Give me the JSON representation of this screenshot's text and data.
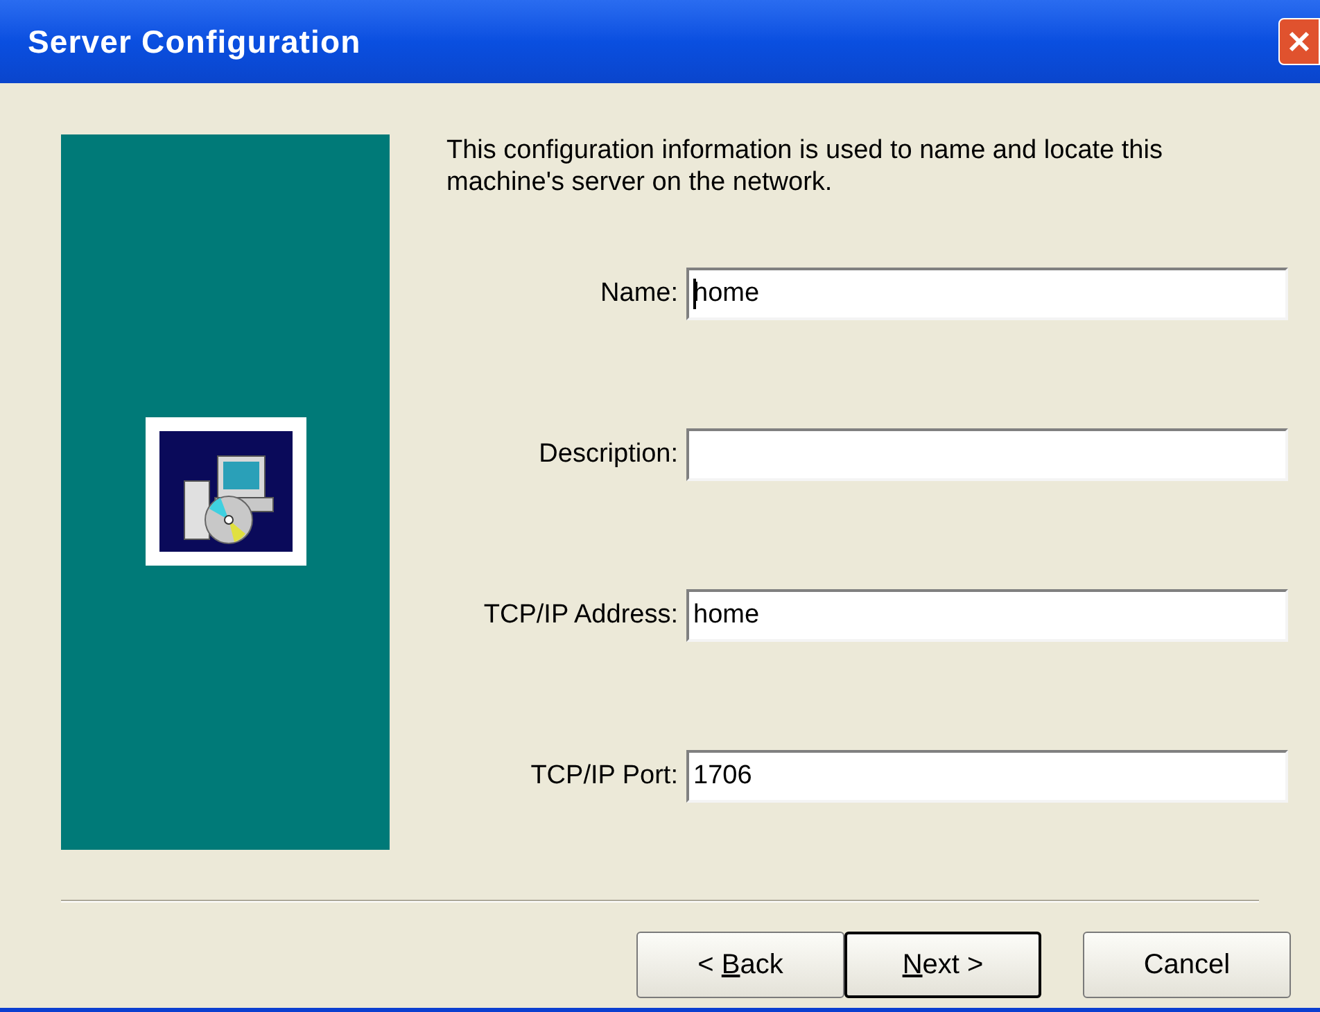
{
  "window": {
    "title": "Server Configuration"
  },
  "intro": "This configuration information is used to name and locate this machine's server on the network.",
  "fields": [
    {
      "label": "Name:",
      "value": "home",
      "focused": true
    },
    {
      "label": "Description:",
      "focused": false
    },
    {
      "label": "TCP/IP Address:",
      "value": "home",
      "focused": false
    },
    {
      "label": "TCP/IP Port:",
      "value": "1706",
      "focused": false
    }
  ],
  "buttons": [
    {
      "before": "< ",
      "access_key": "B",
      "after": "ack",
      "default": false
    },
    {
      "access_key": "N",
      "after": "ext >",
      "default": true
    },
    {
      "before": "Cancel",
      "default": false
    }
  ]
}
